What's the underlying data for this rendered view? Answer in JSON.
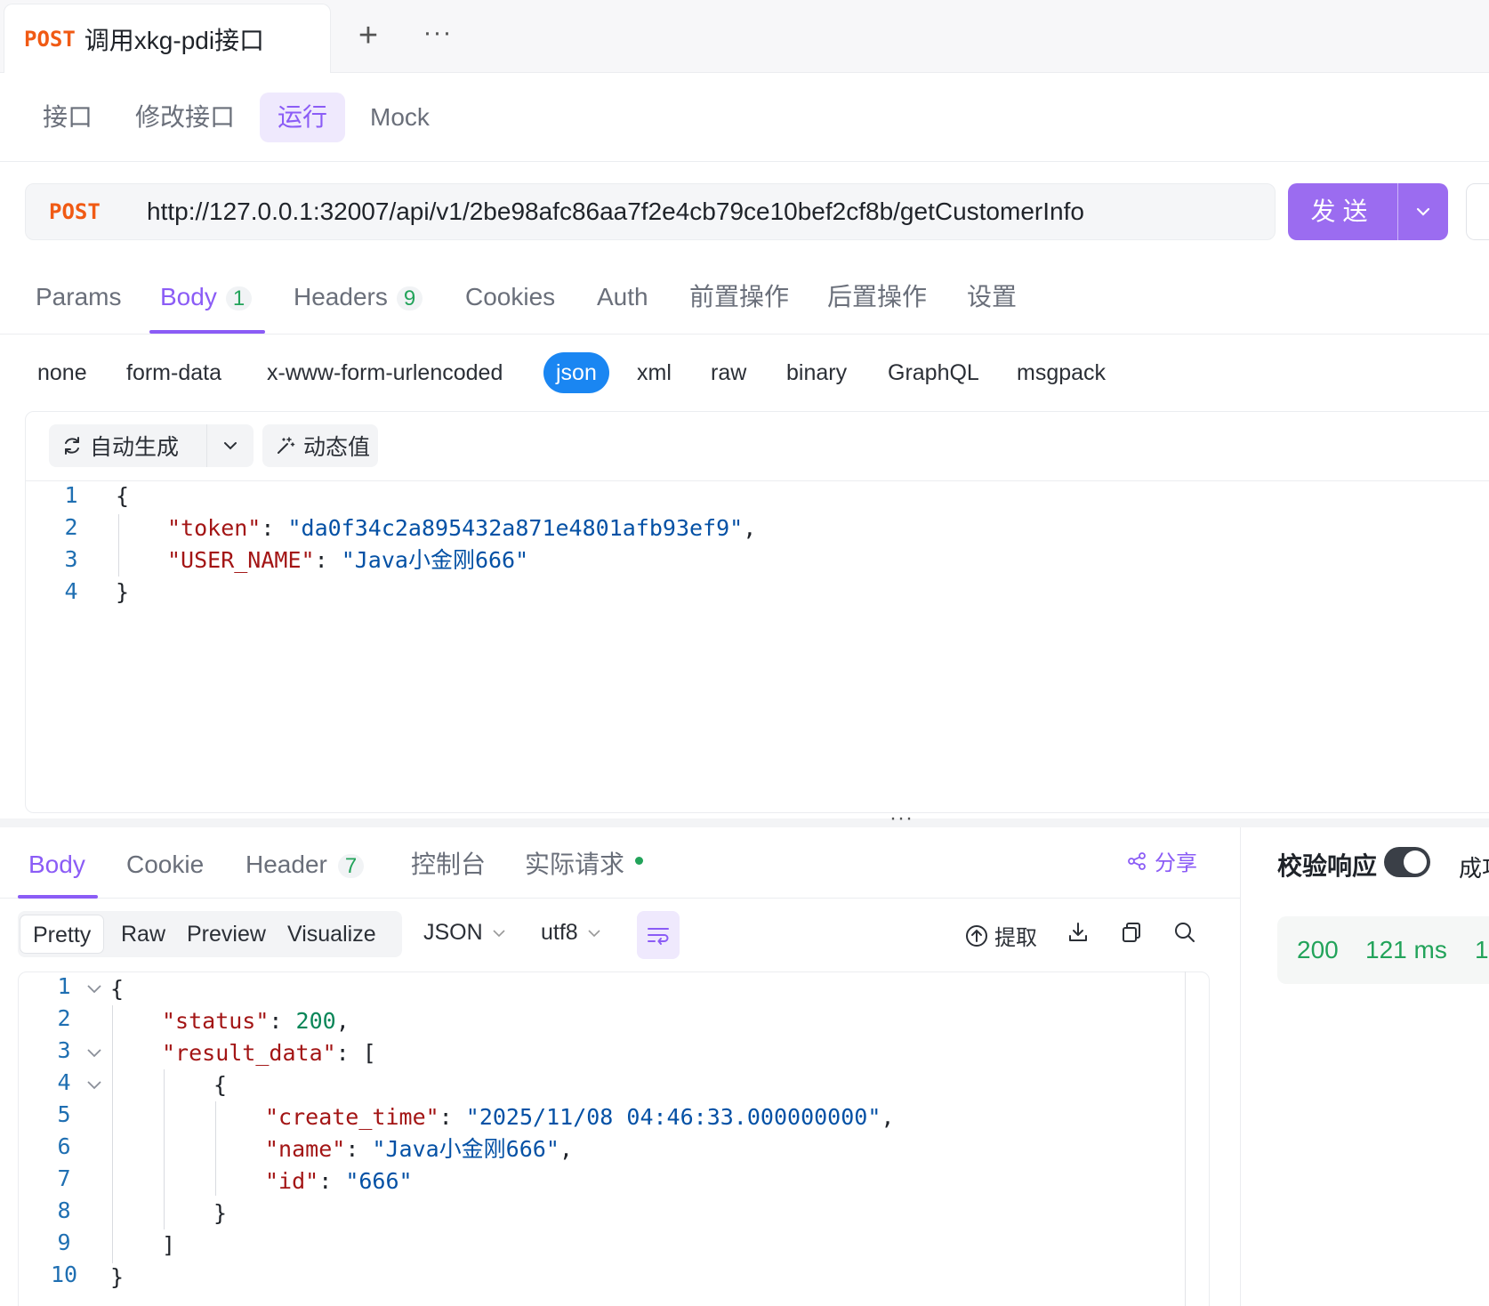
{
  "tabbar": {
    "method": "POST",
    "title": "调用xkg-pdi接口"
  },
  "subtabs": [
    "接口",
    "修改接口",
    "运行",
    "Mock"
  ],
  "request": {
    "method": "POST",
    "url": "http://127.0.0.1:32007/api/v1/2be98afc86aa7f2e4cb79ce10bef2cf8b/getCustomerInfo",
    "send_label": "发送"
  },
  "req_tabs": {
    "params": "Params",
    "body": "Body",
    "body_count": "1",
    "headers": "Headers",
    "headers_count": "9",
    "cookies": "Cookies",
    "auth": "Auth",
    "pre": "前置操作",
    "post": "后置操作",
    "settings": "设置"
  },
  "body_types": [
    "none",
    "form-data",
    "x-www-form-urlencoded",
    "json",
    "xml",
    "raw",
    "binary",
    "GraphQL",
    "msgpack"
  ],
  "req_toolbar": {
    "autogen": "自动生成",
    "dynamic": "动态值"
  },
  "req_code": {
    "line_numbers": [
      "1",
      "2",
      "3",
      "4"
    ],
    "open": "{",
    "close": "}",
    "token_key": "\"token\"",
    "token_val": "\"da0f34c2a895432a871e4801afb93ef9\"",
    "user_key": "\"USER_NAME\"",
    "user_val": "\"Java小金刚666\""
  },
  "resp_tabs": {
    "body": "Body",
    "cookie": "Cookie",
    "header": "Header",
    "header_count": "7",
    "console": "控制台",
    "actual": "实际请求",
    "share": "分享"
  },
  "resp_toolbar": {
    "formats": [
      "Pretty",
      "Raw",
      "Preview",
      "Visualize"
    ],
    "lang": "JSON",
    "encoding": "utf8",
    "extract": "提取"
  },
  "resp_code": {
    "line_numbers": [
      "1",
      "2",
      "3",
      "4",
      "5",
      "6",
      "7",
      "8",
      "9",
      "10"
    ],
    "status_key": "\"status\"",
    "status_val": "200",
    "result_key": "\"result_data\"",
    "create_key": "\"create_time\"",
    "create_val": "\"2025/11/08 04:46:33.000000000\"",
    "name_key": "\"name\"",
    "name_val": "\"Java小金刚666\"",
    "id_key": "\"id\"",
    "id_val": "\"666\""
  },
  "right_panel": {
    "verify_label": "校验响应",
    "verify_on": true,
    "result": "成功",
    "status_code": "200",
    "time": "121 ms",
    "size": "1"
  },
  "colors": {
    "accent": "#8b5cf6",
    "method": "#f05a14",
    "json_active": "#1a86f2",
    "success": "#22a35a"
  }
}
